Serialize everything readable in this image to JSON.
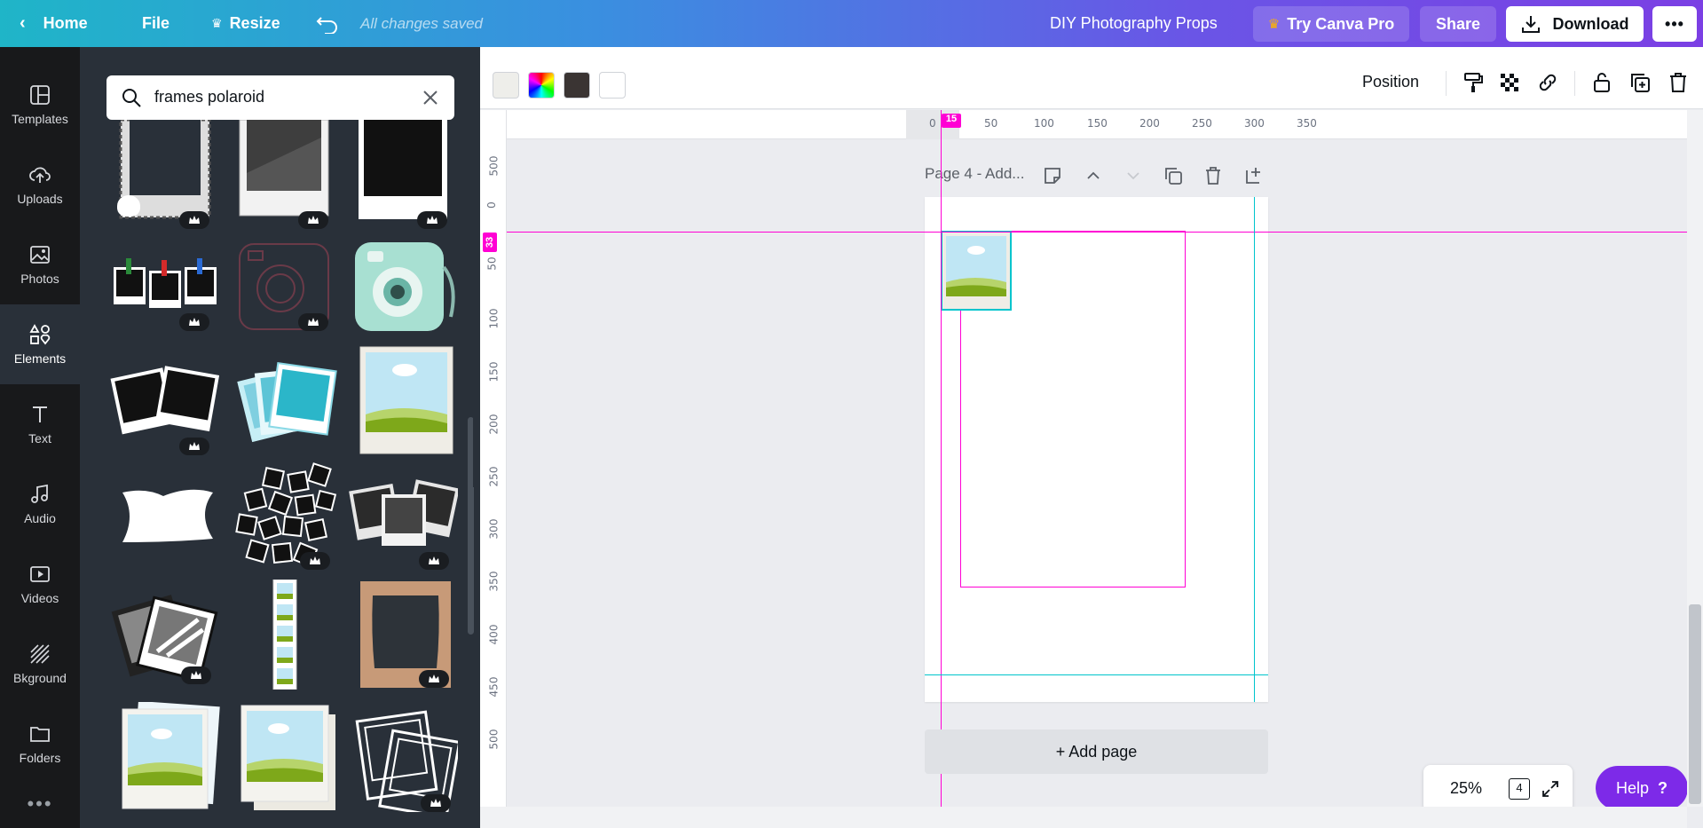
{
  "topbar": {
    "home": "Home",
    "file": "File",
    "resize": "Resize",
    "saved": "All changes saved",
    "design_title": "DIY Photography Props",
    "try_pro": "Try Canva Pro",
    "share": "Share",
    "download": "Download",
    "more": "•••"
  },
  "rail": {
    "items": [
      {
        "label": "Templates",
        "icon": "templates-icon"
      },
      {
        "label": "Uploads",
        "icon": "upload-cloud-icon"
      },
      {
        "label": "Photos",
        "icon": "image-icon"
      },
      {
        "label": "Elements",
        "icon": "shapes-icon"
      },
      {
        "label": "Text",
        "icon": "text-t-icon"
      },
      {
        "label": "Audio",
        "icon": "music-note-icon"
      },
      {
        "label": "Videos",
        "icon": "play-video-icon"
      },
      {
        "label": "Bkground",
        "icon": "hatched-background-icon"
      },
      {
        "label": "Folders",
        "icon": "folder-icon"
      }
    ],
    "more": "•••"
  },
  "search": {
    "value": "frames polaroid"
  },
  "context_toolbar": {
    "colors": [
      "#eeeeea",
      "rainbow",
      "#3a3433",
      "#ffffff"
    ],
    "position": "Position"
  },
  "ruler": {
    "h_ticks": [
      "0",
      "50",
      "100",
      "150",
      "200",
      "250",
      "300",
      "350"
    ],
    "v_ticks": [
      "500",
      "0",
      "50",
      "100",
      "150",
      "200",
      "250",
      "300",
      "350",
      "400",
      "450",
      "500"
    ],
    "h_marker": "15",
    "v_marker": "33"
  },
  "page": {
    "title": "Page 4 - Add..."
  },
  "add_page": "+ Add page",
  "zoom": {
    "level": "25%",
    "page_count": "4"
  },
  "help": {
    "label": "Help",
    "icon": "?"
  },
  "colors": {
    "accent": "#7d2ae8",
    "guide": "#ff00d4",
    "selection": "#00c4cc"
  }
}
